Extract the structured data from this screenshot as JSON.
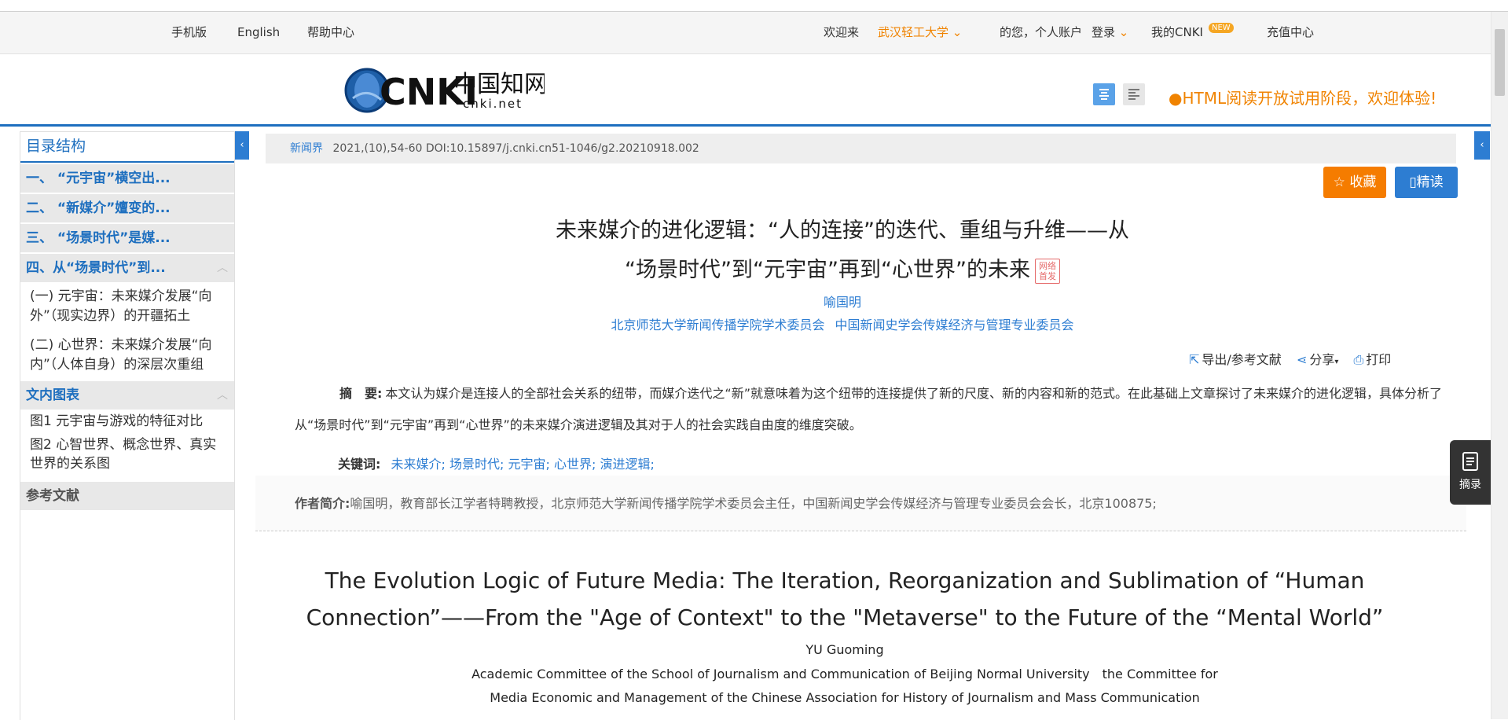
{
  "topbar": {
    "mobile": "手机版",
    "english": "English",
    "help": "帮助中心",
    "welcome": "欢迎来",
    "institution": "武汉轻工大学",
    "greeting": "的您，个人账户",
    "login": "登录",
    "my_cnki": "我的CNKI",
    "new_badge": "NEW",
    "recharge": "充值中心"
  },
  "header": {
    "logo_brand": "CNKI",
    "logo_cn": "中国知网",
    "logo_url": "cnki.net",
    "trial_notice": "HTML阅读开放试用阶段，欢迎体验!"
  },
  "sidebar": {
    "title": "目录结构",
    "sections": [
      {
        "label": "一、 “元宇宙”横空出..."
      },
      {
        "label": "二、 “新媒介”嬗变的..."
      },
      {
        "label": "三、 “场景时代”是媒..."
      },
      {
        "label": "四、从“场景时代”到..."
      }
    ],
    "subsections": [
      {
        "label": "(一) 元宇宙：未来媒介发展“向外”（现实边界）的开疆拓土"
      },
      {
        "label": "(二) 心世界：未来媒介发展“向内”（人体自身）的深层次重组"
      }
    ],
    "figures_title": "文内图表",
    "figures": [
      {
        "label": "图1 元宇宙与游戏的特征对比"
      },
      {
        "label": "图2 心智世界、概念世界、真实世界的关系图"
      }
    ],
    "references": "参考文献"
  },
  "article": {
    "journal": "新闻界",
    "citation": "2021,(10),54-60 DOI:10.15897/j.cnki.cn51-1046/g2.20210918.002",
    "favorite_label": "收藏",
    "intensive_label": "精读",
    "title_line1": "未来媒介的进化逻辑：“人的连接”的迭代、重组与升维——从",
    "title_line2": "“场景时代”到“元宇宙”再到“心世界”的未来",
    "first_badge": "网络首发",
    "author": "喻国明",
    "affiliation1": "北京师范大学新闻传播学院学术委员会",
    "affiliation2": "中国新闻史学会传媒经济与管理专业委员会",
    "tools": {
      "export": "导出/参考文献",
      "share": "分享",
      "print": "打印"
    },
    "abstract_label": "摘　要:",
    "abstract_text": "本文认为媒介是连接人的全部社会关系的纽带，而媒介迭代之“新”就意味着为这个纽带的连接提供了新的尺度、新的内容和新的范式。在此基础上文章探讨了未来媒介的进化逻辑，具体分析了从“场景时代”到“元宇宙”再到“心世界”的未来媒介演进逻辑及其对于人的社会实践自由度的维度突破。",
    "keywords_label": "关键词:",
    "keywords": [
      "未来媒介;",
      "场景时代;",
      "元宇宙;",
      "心世界;",
      "演进逻辑;"
    ],
    "bio_label": "作者简介:",
    "bio_text": "喻国明，教育部长江学者特聘教授，北京师范大学新闻传播学院学术委员会主任，中国新闻史学会传媒经济与管理专业委员会会长，北京100875;",
    "title_en": "The Evolution Logic of Future Media: The Iteration, Reorganization and Sublimation of “Human Connection”——From the \"Age of Context\" to the \"Metaverse\" to the Future of the “Mental World”",
    "author_en": "YU Guoming",
    "affiliation_en": "Academic Committee of the School of Journalism and Communication of Beijing Normal University　the Committee for Media Economic and Management of the Chinese Association for History of Journalism and Mass Communication"
  },
  "widgets": {
    "summary": "摘录"
  },
  "colors": {
    "primary_blue": "#1e6fbf",
    "link_blue": "#2d7dd2",
    "orange": "#f08300",
    "favorite_orange": "#f57c00"
  }
}
